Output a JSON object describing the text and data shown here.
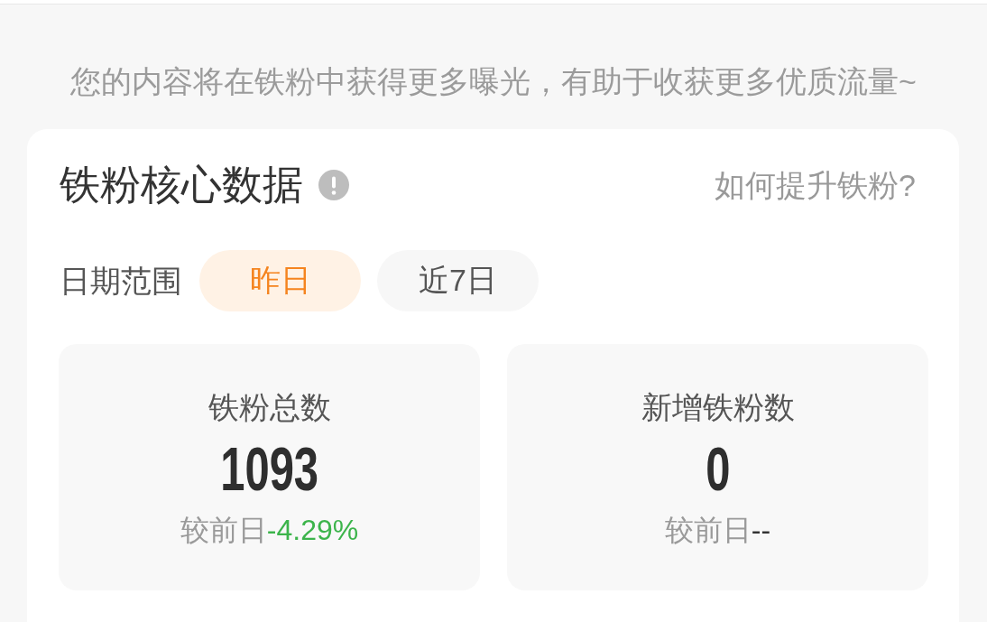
{
  "banner": {
    "text": "您的内容将在铁粉中获得更多曝光，有助于收获更多优质流量~"
  },
  "panel": {
    "title": "铁粉核心数据",
    "help_link": "如何提升铁粉?",
    "date_range": {
      "label": "日期范围",
      "options": [
        {
          "label": "昨日",
          "selected": true
        },
        {
          "label": "近7日",
          "selected": false
        }
      ]
    },
    "stats": [
      {
        "label": "铁粉总数",
        "value": "1093",
        "compare_label": "较前日",
        "change": "-4.29%",
        "color": "#3cb44b"
      },
      {
        "label": "新增铁粉数",
        "value": "0",
        "compare_label": "较前日",
        "change": "--",
        "color": "#333333"
      }
    ]
  }
}
